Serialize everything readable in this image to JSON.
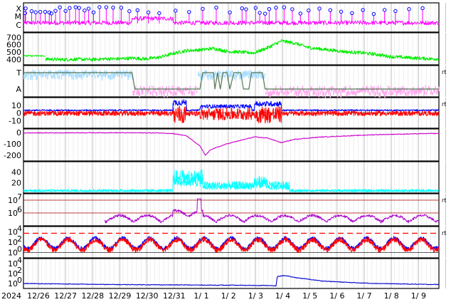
{
  "chart_data": {
    "type": "line",
    "date_axis": {
      "year_label": "2024",
      "day_labels": [
        "12/26",
        "12/27",
        "12/28",
        "12/29",
        "12/30",
        "12/31",
        "1/ 1",
        "1/ 2",
        "1/ 3",
        "1/ 4",
        "1/ 5",
        "1/ 6",
        "1/ 7",
        "1/ 8",
        "1/ 9"
      ]
    },
    "panels": [
      {
        "id": "xray",
        "ylabels": [
          "X",
          "M",
          "C"
        ],
        "color": "#ff00ff",
        "marker_color": "#0000ff",
        "baseline": 0.82,
        "noise": 0.1,
        "spikes": [
          0.06,
          0.08,
          0.3,
          0.45,
          0.62,
          0.8,
          0.95,
          1.03,
          1.18,
          1.34,
          1.55,
          1.7,
          1.92,
          2.05,
          2.25,
          2.4,
          2.58,
          2.8,
          3.05,
          3.3,
          3.6,
          3.9,
          4.2,
          4.6,
          5.0,
          5.6,
          6.1,
          6.6,
          7.1,
          7.6,
          8.05,
          8.2,
          8.55,
          8.7,
          8.9,
          9.05,
          9.3,
          9.6,
          9.9,
          10.2,
          10.5,
          10.9,
          11.3,
          11.7,
          12.1,
          12.5,
          12.9,
          13.3,
          13.7,
          14.2,
          14.7
        ]
      },
      {
        "id": "wind-speed",
        "yticks": [
          700,
          600,
          500,
          400
        ],
        "ylim": [
          330,
          760
        ],
        "color": "#00ee00",
        "profile": [
          [
            0,
            450
          ],
          [
            0.5,
            410
          ],
          [
            1,
            405
          ],
          [
            1.5,
            400
          ],
          [
            2,
            405
          ],
          [
            2.5,
            400
          ],
          [
            3,
            410
          ],
          [
            3.5,
            410
          ],
          [
            4,
            420
          ],
          [
            4.5,
            410
          ],
          [
            5,
            430
          ],
          [
            5.5,
            480
          ],
          [
            6,
            520
          ],
          [
            6.5,
            530
          ],
          [
            7,
            550
          ],
          [
            7.5,
            510
          ],
          [
            8,
            500
          ],
          [
            8.5,
            490
          ],
          [
            9,
            560
          ],
          [
            9.5,
            650
          ],
          [
            10,
            620
          ],
          [
            10.5,
            560
          ],
          [
            11,
            540
          ],
          [
            11.5,
            520
          ],
          [
            12,
            500
          ],
          [
            12.5,
            490
          ],
          [
            13,
            470
          ],
          [
            13.5,
            440
          ],
          [
            14,
            430
          ],
          [
            14.5,
            420
          ],
          [
            15,
            410
          ]
        ]
      },
      {
        "id": "imf-sector",
        "ylabels": [
          "T",
          "A"
        ],
        "colors": [
          "#aaddff",
          "#ffaaee",
          "#557755"
        ],
        "right_mark": "rt"
      },
      {
        "id": "imf-components",
        "yticks": [
          10,
          0,
          -10
        ],
        "ylim": [
          -20,
          20
        ],
        "colors": [
          "#0000ff",
          "#ff0000"
        ],
        "right_mark": "rt"
      },
      {
        "id": "dst",
        "yticks": [
          0,
          -100,
          -200
        ],
        "ylim": [
          -250,
          30
        ],
        "color": "#cc00cc",
        "profile": [
          [
            0,
            -5
          ],
          [
            3,
            -3
          ],
          [
            5,
            -5
          ],
          [
            5.5,
            -10
          ],
          [
            6,
            -30
          ],
          [
            6.5,
            -120
          ],
          [
            6.7,
            -200
          ],
          [
            6.9,
            -150
          ],
          [
            7.5,
            -100
          ],
          [
            8,
            -70
          ],
          [
            8.5,
            -40
          ],
          [
            9,
            -50
          ],
          [
            9.5,
            -90
          ],
          [
            10,
            -60
          ],
          [
            11,
            -40
          ],
          [
            12,
            -30
          ],
          [
            13,
            -20
          ],
          [
            14,
            -15
          ],
          [
            15,
            -10
          ]
        ]
      },
      {
        "id": "aurora-power",
        "yticks": [
          40,
          20
        ],
        "ylim": [
          0,
          60
        ],
        "color": "#00ffff"
      },
      {
        "id": "electron-flux",
        "yticks": [
          "10^7",
          "10^6"
        ],
        "ylim": [
          5,
          7.5
        ],
        "color": "#aa00cc",
        "right_mark": "rt"
      },
      {
        "id": "geo-flux",
        "yticks": [
          "10^4",
          "10^2",
          "10^0"
        ],
        "ylim": [
          -1,
          5
        ],
        "colors": [
          "#0000ff",
          "#ff0000"
        ],
        "threshold": 3.7,
        "threshold_color": "#ff0000",
        "right_mark": "rt"
      },
      {
        "id": "proton-flux",
        "yticks": [
          "10^4",
          "10^2",
          "10^0"
        ],
        "ylim": [
          -1,
          5
        ],
        "color": "#0000cc",
        "profile": [
          [
            0,
            0
          ],
          [
            3,
            -0.2
          ],
          [
            6,
            -0.3
          ],
          [
            9,
            -0.4
          ],
          [
            9.3,
            -0.5
          ],
          [
            9.35,
            1.4
          ],
          [
            9.6,
            1.6
          ],
          [
            10,
            1.2
          ],
          [
            11,
            0.5
          ],
          [
            12,
            0.2
          ],
          [
            13,
            0
          ],
          [
            14,
            -0.1
          ],
          [
            15,
            -0.2
          ]
        ]
      }
    ]
  }
}
